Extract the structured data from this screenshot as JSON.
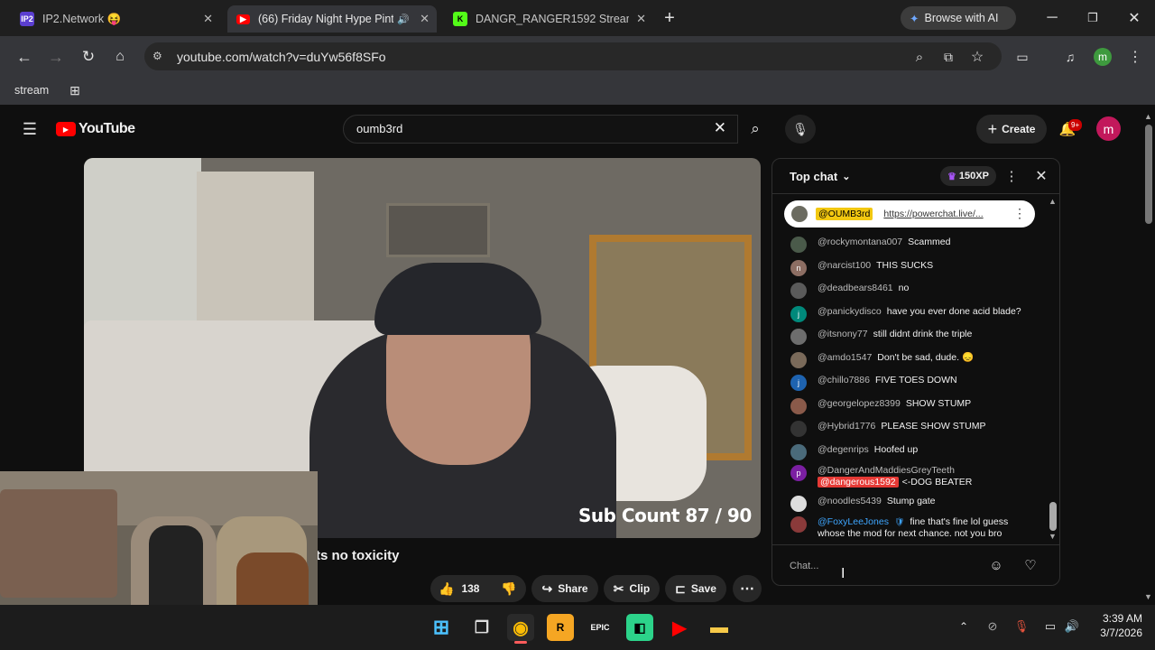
{
  "tabs": [
    {
      "title": "IP2.Network 😝",
      "favicon": "IP2"
    },
    {
      "title": "(66) Friday Night Hype Pint",
      "favicon": "yt"
    },
    {
      "title": "DANGR_RANGER1592 Stream -",
      "favicon": "K"
    }
  ],
  "browse_ai": "Browse with AI",
  "url": "youtube.com/watch?v=duYw56f8SFo",
  "bookmark": "stream",
  "youtube": {
    "logo": "YouTube",
    "search_value": "oumb3rd",
    "create": "Create",
    "notifications": "9+",
    "avatar": "m"
  },
  "video": {
    "overlay": "Sub Count  87 / 90",
    "title_partial": "ts no toxicity",
    "likes": "138",
    "share": "Share",
    "clip": "Clip",
    "save": "Save"
  },
  "chat": {
    "header": "Top chat",
    "xp": "150XP",
    "pinned_user": "@OUMB3rd",
    "pinned_link": "https://powerchat.live/...",
    "input_placeholder": "Chat...",
    "messages": [
      {
        "author": "@rockymontana007",
        "text": "Scammed",
        "avatar_color": "#4a5a4a",
        "initial": ""
      },
      {
        "author": "@narcist100",
        "text": "THIS SUCKS",
        "avatar_color": "#8d6e63",
        "initial": "n"
      },
      {
        "author": "@deadbears8461",
        "text": "no",
        "avatar_color": "#5a5a5a",
        "initial": ""
      },
      {
        "author": "@panickydisco",
        "text": "have you ever done acid blade?",
        "avatar_color": "#00897b",
        "initial": "j"
      },
      {
        "author": "@itsnony77",
        "text": "still didnt drink the triple",
        "avatar_color": "#6d6d6d",
        "initial": ""
      },
      {
        "author": "@amdo1547",
        "text": "Don't be sad, dude. 😞",
        "avatar_color": "#7a6a5a",
        "initial": ""
      },
      {
        "author": "@chillo7886",
        "text": "FIVE TOES DOWN",
        "avatar_color": "#1e63b0",
        "initial": "j"
      },
      {
        "author": "@georgelopez8399",
        "text": "SHOW STUMP",
        "avatar_color": "#8a5a4a",
        "initial": ""
      },
      {
        "author": "@Hybrid1776",
        "text": "PLEASE SHOW STUMP",
        "avatar_color": "#333333",
        "initial": ""
      },
      {
        "author": "@degenrips",
        "text": "Hoofed up",
        "avatar_color": "#4a6a7a",
        "initial": ""
      },
      {
        "author": "@DangerAndMaddiesGreyTeeth",
        "text": "<-DOG BEATER",
        "mention": "@dangerous1592",
        "avatar_color": "#7b1fa2",
        "initial": "p"
      },
      {
        "author": "@noodles5439",
        "text": "Stump gate",
        "avatar_color": "#dddddd",
        "initial": ""
      },
      {
        "author": "@FoxyLeeJones",
        "text": "fine that's fine lol guess whose the mod for next chance. not you bro",
        "avatar_color": "#8a3a3a",
        "initial": ""
      }
    ]
  },
  "clock": {
    "time": "3:39 AM",
    "date": "3/7/2026"
  }
}
